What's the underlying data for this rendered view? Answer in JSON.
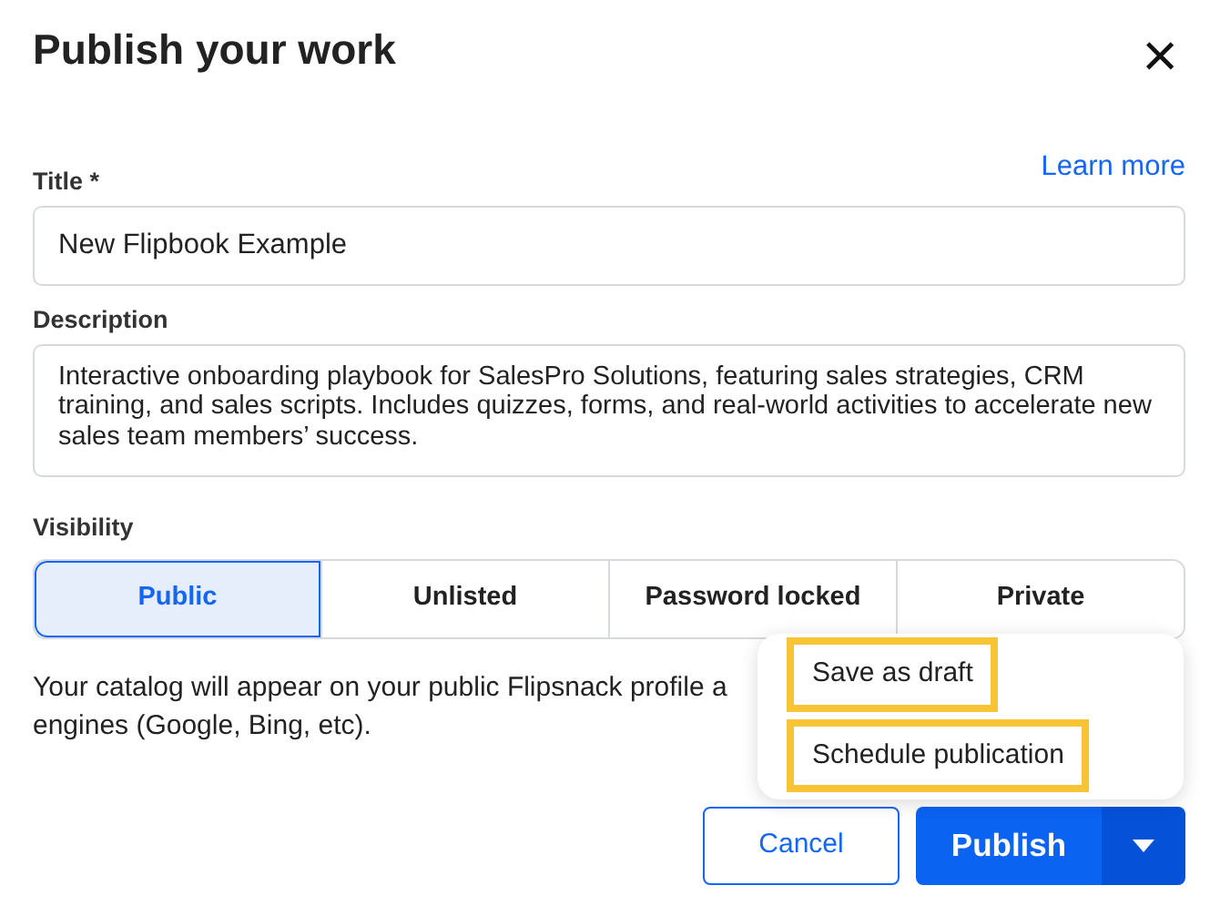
{
  "dialog": {
    "title": "Publish your work",
    "close_icon": "×"
  },
  "learn_more": "Learn more",
  "title_field": {
    "label": "Title *",
    "value": "New Flipbook Example"
  },
  "description_field": {
    "label": "Description",
    "value": "Interactive onboarding playbook for SalesPro Solutions, featuring sales strategies, CRM training, and sales scripts. Includes quizzes, forms, and real-world activities to accelerate new sales team members’ success."
  },
  "visibility": {
    "label": "Visibility",
    "options": [
      {
        "label": "Public",
        "selected": true
      },
      {
        "label": "Unlisted",
        "selected": false
      },
      {
        "label": "Password locked",
        "selected": false
      },
      {
        "label": "Private",
        "selected": false
      }
    ]
  },
  "help_text_lines": [
    "Your catalog will appear on your public Flipsnack profile a",
    "engines (Google, Bing, etc)."
  ],
  "menu": {
    "items": [
      {
        "label": "Save as draft",
        "highlighted": true
      },
      {
        "label": "Schedule publication",
        "highlighted": true
      }
    ]
  },
  "buttons": {
    "cancel": "Cancel",
    "publish": "Publish"
  }
}
